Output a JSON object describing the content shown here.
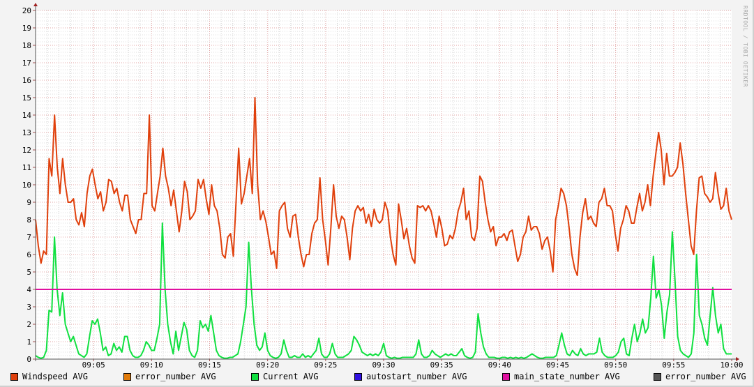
{
  "chart_data": {
    "type": "line",
    "title": "",
    "xlabel": "",
    "ylabel": "",
    "x_unit": "minutes after 09:00",
    "xlim": [
      0,
      60
    ],
    "ylim": [
      0,
      20
    ],
    "grid": true,
    "x_ticks": [
      {
        "v": 5,
        "label": "09:05"
      },
      {
        "v": 10,
        "label": "09:10"
      },
      {
        "v": 15,
        "label": "09:15"
      },
      {
        "v": 20,
        "label": "09:20"
      },
      {
        "v": 25,
        "label": "09:25"
      },
      {
        "v": 30,
        "label": "09:30"
      },
      {
        "v": 35,
        "label": "09:35"
      },
      {
        "v": 40,
        "label": "09:40"
      },
      {
        "v": 45,
        "label": "09:45"
      },
      {
        "v": 50,
        "label": "09:50"
      },
      {
        "v": 55,
        "label": "09:55"
      },
      {
        "v": 60,
        "label": "10:00"
      }
    ],
    "y_ticks": [
      "0",
      "1",
      "2",
      "3",
      "4",
      "5",
      "6",
      "7",
      "8",
      "9",
      "10",
      "11",
      "12",
      "13",
      "14",
      "15",
      "16",
      "17",
      "18",
      "19",
      "20"
    ],
    "legend_placement": "bottom",
    "watermark": "RRDTOOL / TOBI OETIKER",
    "series": [
      {
        "name": "Windspeed AVG",
        "color": "#e0400c",
        "values": [
          8,
          6.5,
          5.5,
          6.2,
          6,
          11.5,
          10.5,
          14,
          11,
          9.5,
          11.5,
          10,
          9,
          9,
          9.2,
          8,
          7.7,
          8.4,
          7.6,
          9.5,
          10.5,
          10.9,
          10,
          9.2,
          9.6,
          8.5,
          9,
          10.3,
          10.2,
          9.5,
          9.8,
          9,
          8.5,
          9.4,
          9.4,
          8,
          7.6,
          7.2,
          8,
          8,
          9.5,
          9.5,
          14,
          8.8,
          8.5,
          9.5,
          10.5,
          12.1,
          10.5,
          9.8,
          8.8,
          9.7,
          8.5,
          7.3,
          8.5,
          10.2,
          9.6,
          8,
          8.2,
          8.5,
          10.3,
          9.8,
          10.3,
          9.2,
          8.3,
          10,
          8.8,
          8.5,
          7.5,
          6,
          5.8,
          7,
          7.2,
          5.9,
          9,
          12.1,
          8.9,
          9.5,
          10.5,
          11.5,
          9.5,
          15,
          10,
          8,
          8.5,
          7.9,
          7,
          6,
          6.2,
          5.2,
          8.5,
          8.8,
          9,
          7.5,
          7,
          8.2,
          8.3,
          7,
          6,
          5.3,
          6,
          6,
          7.2,
          7.8,
          8,
          10.4,
          8,
          6.8,
          5.4,
          7.5,
          10,
          8.2,
          7.5,
          8.2,
          8,
          7,
          5.7,
          7.5,
          8.5,
          8.8,
          8.5,
          8.7,
          7.8,
          8.3,
          7.6,
          8.6,
          8,
          7.8,
          8,
          9,
          8.5,
          7,
          6,
          5.4,
          8.9,
          8,
          6.9,
          7.5,
          6.5,
          5.8,
          5.5,
          8.8,
          8.7,
          8.8,
          8.5,
          8.8,
          8.5,
          7.8,
          7,
          8.2,
          7.5,
          6.5,
          6.6,
          7.1,
          6.9,
          7.5,
          8.5,
          9,
          9.8,
          8,
          8.5,
          7,
          6.8,
          7.5,
          10.5,
          10.2,
          9,
          8,
          7.3,
          7.6,
          6.5,
          7,
          7,
          7.2,
          6.8,
          7.3,
          7.4,
          6.5,
          5.6,
          6,
          7,
          7.3,
          8.2,
          7.4,
          7.6,
          7.6,
          7.2,
          6.3,
          6.8,
          7,
          6.2,
          5,
          8,
          8.8,
          9.8,
          9.5,
          8.8,
          7.5,
          6,
          5.2,
          4.8,
          7,
          8.4,
          9.2,
          8,
          8.2,
          7.8,
          7.6,
          9,
          9.2,
          9.8,
          8.8,
          8.8,
          8.5,
          7.2,
          6.2,
          7.5,
          8,
          8.8,
          8.5,
          7.8,
          7.8,
          8.7,
          9.5,
          8.5,
          9,
          10,
          8.8,
          10.5,
          11.8,
          13,
          12,
          10,
          11.8,
          10.5,
          10.5,
          10.7,
          11,
          12.4,
          11.2,
          9.5,
          8,
          6.5,
          6,
          8.5,
          10.4,
          10.5,
          9.5,
          9.3,
          9,
          9.2,
          10.7,
          9.5,
          8.6,
          8.8,
          9.8,
          8.5,
          8
        ]
      },
      {
        "name": "error_number AVG",
        "color": "#e07a0a",
        "values": []
      },
      {
        "name": "Current AVG",
        "color": "#10e040",
        "values": [
          0.2,
          0.1,
          0.05,
          0.1,
          0.5,
          2.8,
          2.7,
          7,
          4,
          2.5,
          3.8,
          2,
          1.5,
          1,
          1.3,
          0.8,
          0.3,
          0.2,
          0.1,
          0.3,
          1.3,
          2.2,
          2,
          2.3,
          1.5,
          0.5,
          0.7,
          0.2,
          0.3,
          0.9,
          0.5,
          0.7,
          0.4,
          1.3,
          1.3,
          0.5,
          0.2,
          0.1,
          0.1,
          0.2,
          0.5,
          1,
          0.8,
          0.5,
          0.5,
          1.2,
          2,
          7.8,
          4,
          2,
          1,
          0.3,
          1.6,
          0.5,
          1.3,
          2.1,
          1.7,
          0.5,
          0.2,
          0.1,
          0.5,
          2.2,
          1.8,
          2,
          1.6,
          2.5,
          1.5,
          0.5,
          0.2,
          0.1,
          0.05,
          0.05,
          0.1,
          0.1,
          0.2,
          0.3,
          1,
          2,
          3,
          6.7,
          4,
          2,
          0.8,
          0.5,
          0.7,
          1.5,
          0.5,
          0.2,
          0.1,
          0.05,
          0.1,
          0.3,
          1.1,
          0.5,
          0.1,
          0.1,
          0.2,
          0.1,
          0.1,
          0.3,
          0.1,
          0.2,
          0.1,
          0.3,
          0.5,
          1.2,
          0.3,
          0.1,
          0.1,
          0.3,
          0.9,
          0.3,
          0.1,
          0.1,
          0.1,
          0.2,
          0.3,
          0.5,
          1.3,
          1.1,
          0.8,
          0.4,
          0.3,
          0.2,
          0.3,
          0.2,
          0.3,
          0.2,
          0.4,
          0.9,
          0.2,
          0.1,
          0.05,
          0.1,
          0.05,
          0.05,
          0.1,
          0.1,
          0.1,
          0.1,
          0.1,
          0.3,
          1.1,
          0.3,
          0.1,
          0.1,
          0.2,
          0.5,
          0.3,
          0.2,
          0.1,
          0.2,
          0.3,
          0.2,
          0.3,
          0.2,
          0.2,
          0.4,
          0.6,
          0.2,
          0.1,
          0.05,
          0.1,
          0.4,
          2.6,
          1.5,
          0.7,
          0.3,
          0.1,
          0.1,
          0.1,
          0.05,
          0.05,
          0.1,
          0.1,
          0.05,
          0.1,
          0.05,
          0.1,
          0.05,
          0.1,
          0.05,
          0.1,
          0.2,
          0.3,
          0.2,
          0.1,
          0.05,
          0.05,
          0.1,
          0.1,
          0.1,
          0.1,
          0.2,
          0.8,
          1.5,
          0.8,
          0.3,
          0.2,
          0.5,
          0.3,
          0.2,
          0.6,
          0.3,
          0.2,
          0.3,
          0.3,
          0.3,
          0.4,
          1.2,
          0.4,
          0.2,
          0.1,
          0.1,
          0.1,
          0.2,
          0.4,
          1,
          1.2,
          0.3,
          0.2,
          1.2,
          2,
          1,
          1.5,
          2.3,
          1.5,
          1.8,
          3.5,
          5.9,
          3.5,
          4,
          3.1,
          1.2,
          2.7,
          3.7,
          7.3,
          4.5,
          1.3,
          0.5,
          0.3,
          0.2,
          0.1,
          0.3,
          1.5,
          6,
          2.5,
          2,
          1.2,
          0.8,
          2.5,
          4.1,
          2.5,
          1.5,
          2,
          0.6,
          0.3,
          0.3,
          0.3
        ]
      },
      {
        "name": "autostart_number AVG",
        "color": "#3010e0",
        "values": []
      },
      {
        "name": "main_state_number AVG",
        "color": "#e010a0",
        "values": [
          4,
          4
        ]
      },
      {
        "name": "error_number AVG",
        "color": "#555555",
        "values": []
      }
    ]
  }
}
